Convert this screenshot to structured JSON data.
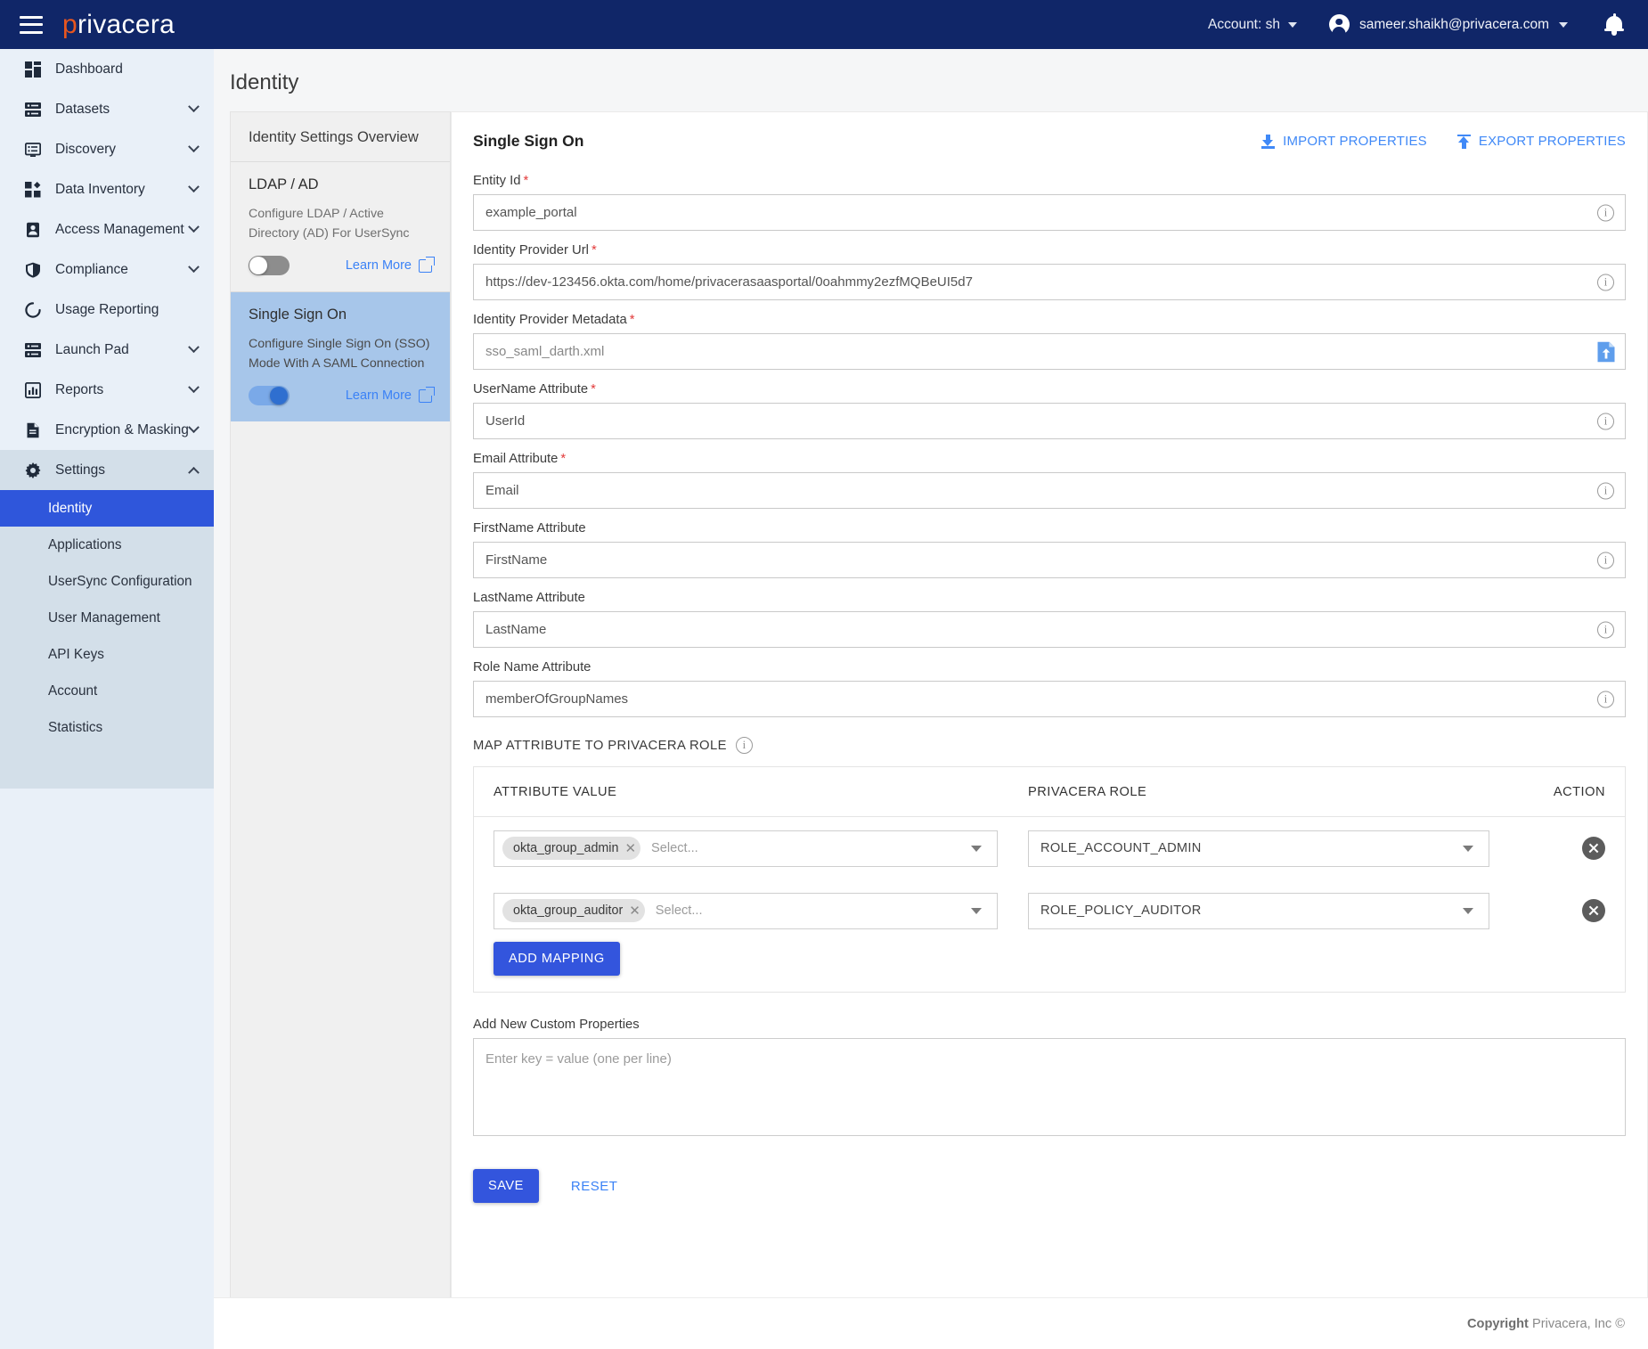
{
  "topbar": {
    "brand_p": "p",
    "brand_rest": "rivacera",
    "account_label": "Account: sh",
    "user_email": "sameer.shaikh@privacera.com"
  },
  "sidebar": {
    "items": [
      {
        "label": "Dashboard",
        "icon": "dashboard-icon",
        "expandable": false
      },
      {
        "label": "Datasets",
        "icon": "datasets-icon",
        "expandable": true
      },
      {
        "label": "Discovery",
        "icon": "discovery-icon",
        "expandable": true
      },
      {
        "label": "Data Inventory",
        "icon": "data-inventory-icon",
        "expandable": true
      },
      {
        "label": "Access Management",
        "icon": "access-management-icon",
        "expandable": true
      },
      {
        "label": "Compliance",
        "icon": "shield-icon",
        "expandable": true
      },
      {
        "label": "Usage Reporting",
        "icon": "usage-reporting-icon",
        "expandable": false
      },
      {
        "label": "Launch Pad",
        "icon": "launch-pad-icon",
        "expandable": true
      },
      {
        "label": "Reports",
        "icon": "reports-icon",
        "expandable": true
      },
      {
        "label": "Encryption & Masking",
        "icon": "encryption-masking-icon",
        "expandable": true
      },
      {
        "label": "Settings",
        "icon": "gear-icon",
        "expandable": true,
        "expanded": true
      }
    ],
    "settings_children": [
      {
        "label": "Identity",
        "active": true
      },
      {
        "label": "Applications",
        "active": false
      },
      {
        "label": "UserSync Configuration",
        "active": false
      },
      {
        "label": "User Management",
        "active": false
      },
      {
        "label": "API Keys",
        "active": false
      },
      {
        "label": "Account",
        "active": false
      },
      {
        "label": "Statistics",
        "active": false
      }
    ]
  },
  "page": {
    "title": "Identity"
  },
  "overview": {
    "header": "Identity Settings Overview",
    "cards": [
      {
        "title": "LDAP / AD",
        "description": "Configure LDAP / Active Directory (AD) For UserSync",
        "toggle_on": false,
        "learn_more": "Learn More"
      },
      {
        "title": "Single Sign On",
        "description": "Configure Single Sign On (SSO) Mode With A SAML Connection",
        "toggle_on": true,
        "learn_more": "Learn More"
      }
    ]
  },
  "form": {
    "title": "Single Sign On",
    "import_label": "IMPORT PROPERTIES",
    "export_label": "EXPORT PROPERTIES",
    "fields": [
      {
        "label": "Entity Id",
        "required": true,
        "value": "example_portal",
        "adornment": "info"
      },
      {
        "label": "Identity Provider Url",
        "required": true,
        "value": "https://dev-123456.okta.com/home/privacerasaasportal/0oahmmy2ezfMQBeUI5d7",
        "adornment": "info"
      },
      {
        "label": "Identity Provider Metadata",
        "required": true,
        "value": "sso_saml_darth.xml",
        "adornment": "file"
      },
      {
        "label": "UserName Attribute",
        "required": true,
        "value": "UserId",
        "adornment": "info"
      },
      {
        "label": "Email Attribute",
        "required": true,
        "value": "Email",
        "adornment": "info"
      },
      {
        "label": "FirstName Attribute",
        "required": false,
        "value": "FirstName",
        "adornment": "info"
      },
      {
        "label": "LastName Attribute",
        "required": false,
        "value": "LastName",
        "adornment": "info"
      },
      {
        "label": "Role Name Attribute",
        "required": false,
        "value": "memberOfGroupNames",
        "adornment": "info"
      }
    ],
    "mapping": {
      "section_label": "MAP ATTRIBUTE TO PRIVACERA ROLE",
      "columns": [
        "ATTRIBUTE VALUE",
        "PRIVACERA ROLE",
        "ACTION"
      ],
      "select_placeholder": "Select...",
      "rows": [
        {
          "attribute_value": "okta_group_admin",
          "privacera_role": "ROLE_ACCOUNT_ADMIN"
        },
        {
          "attribute_value": "okta_group_auditor",
          "privacera_role": "ROLE_POLICY_AUDITOR"
        }
      ],
      "add_mapping_label": "ADD MAPPING"
    },
    "custom_properties": {
      "label": "Add New Custom Properties",
      "placeholder": "Enter key = value (one per line)",
      "value": ""
    },
    "save_label": "SAVE",
    "reset_label": "RESET"
  },
  "footer": {
    "copyright_bold": "Copyright",
    "copyright_rest": " Privacera, Inc ©"
  }
}
